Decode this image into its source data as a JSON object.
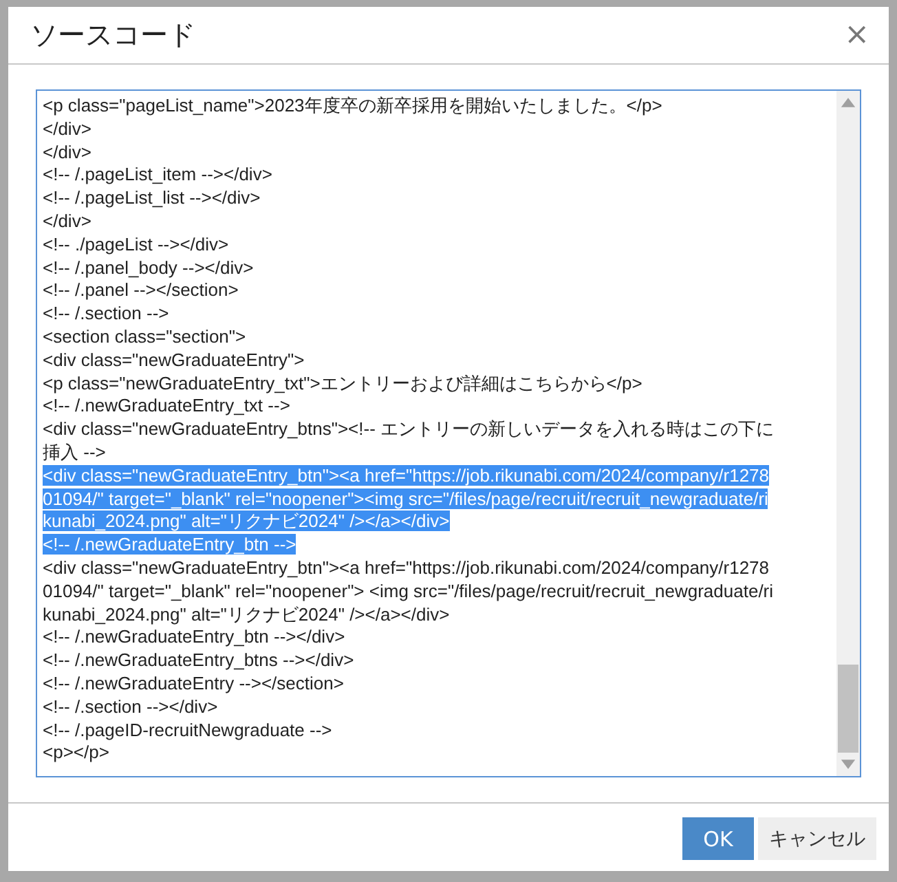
{
  "dialog": {
    "title": "ソースコード",
    "close": "×"
  },
  "code_lines": [
    {
      "text": "<p class=\"pageList_name\">2023年度卒の新卒採用を開始いたしました。</p>",
      "selected": false
    },
    {
      "text": "</div>",
      "selected": false
    },
    {
      "text": "</div>",
      "selected": false
    },
    {
      "text": "<!-- /.pageList_item --></div>",
      "selected": false
    },
    {
      "text": "<!-- /.pageList_list --></div>",
      "selected": false
    },
    {
      "text": "</div>",
      "selected": false
    },
    {
      "text": "<!-- ./pageList --></div>",
      "selected": false
    },
    {
      "text": "<!-- /.panel_body --></div>",
      "selected": false
    },
    {
      "text": "<!-- /.panel --></section>",
      "selected": false
    },
    {
      "text": "<!-- /.section -->",
      "selected": false
    },
    {
      "text": "<section class=\"section\">",
      "selected": false
    },
    {
      "text": "<div class=\"newGraduateEntry\">",
      "selected": false
    },
    {
      "text": "<p class=\"newGraduateEntry_txt\">エントリーおよび詳細はこちらから</p>",
      "selected": false
    },
    {
      "text": "<!-- /.newGraduateEntry_txt -->",
      "selected": false
    },
    {
      "text": "<div class=\"newGraduateEntry_btns\"><!-- エントリーの新しいデータを入れる時はこの下に",
      "selected": false
    },
    {
      "text": "挿入 -->",
      "selected": false
    },
    {
      "text": "<div class=\"newGraduateEntry_btn\"><a href=\"https://job.rikunabi.com/2024/company/r1278",
      "selected": true
    },
    {
      "text": "01094/\" target=\"_blank\" rel=\"noopener\"><img src=\"/files/page/recruit/recruit_newgraduate/ri",
      "selected": true
    },
    {
      "text": "kunabi_2024.png\" alt=\"リクナビ2024\" /></a></div>",
      "selected": true
    },
    {
      "text": "<!-- /.newGraduateEntry_btn -->",
      "selected": true
    },
    {
      "text": "<div class=\"newGraduateEntry_btn\"><a href=\"https://job.rikunabi.com/2024/company/r1278",
      "selected": false
    },
    {
      "text": "01094/\" target=\"_blank\" rel=\"noopener\"> <img src=\"/files/page/recruit/recruit_newgraduate/ri",
      "selected": false
    },
    {
      "text": "kunabi_2024.png\" alt=\"リクナビ2024\" /></a></div>",
      "selected": false
    },
    {
      "text": "<!-- /.newGraduateEntry_btn --></div>",
      "selected": false
    },
    {
      "text": "<!-- /.newGraduateEntry_btns --></div>",
      "selected": false
    },
    {
      "text": "<!-- /.newGraduateEntry --></section>",
      "selected": false
    },
    {
      "text": "<!-- /.section --></div>",
      "selected": false
    },
    {
      "text": "<!-- /.pageID-recruitNewgraduate -->",
      "selected": false
    },
    {
      "text": "<p></p>",
      "selected": false
    }
  ],
  "buttons": [
    {
      "label": "OK",
      "kind": "primary"
    },
    {
      "label": "キャンセル",
      "kind": "secondary"
    }
  ]
}
